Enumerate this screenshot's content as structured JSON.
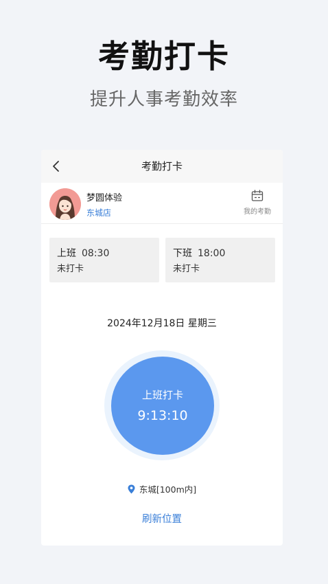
{
  "promo": {
    "title": "考勤打卡",
    "subtitle": "提升人事考勤效率"
  },
  "nav": {
    "title": "考勤打卡",
    "back_icon": "chevron-left-icon"
  },
  "user": {
    "name": "梦圆体验",
    "store": "东城店",
    "my_attendance_label": "我的考勤",
    "my_attendance_icon": "calendar-icon"
  },
  "shifts": [
    {
      "label": "上班",
      "time": "08:30",
      "status": "未打卡"
    },
    {
      "label": "下班",
      "time": "18:00",
      "status": "未打卡"
    }
  ],
  "date": "2024年12月18日 星期三",
  "clock": {
    "label": "上班打卡",
    "time": "9:13:10"
  },
  "location": {
    "text": "东城[100m内]",
    "icon": "location-pin-icon"
  },
  "refresh_label": "刷新位置",
  "colors": {
    "background": "#f2f4f8",
    "accent": "#3a7fd8",
    "clock_button": "#5b98ee",
    "clock_ring": "#eaf3fd"
  }
}
